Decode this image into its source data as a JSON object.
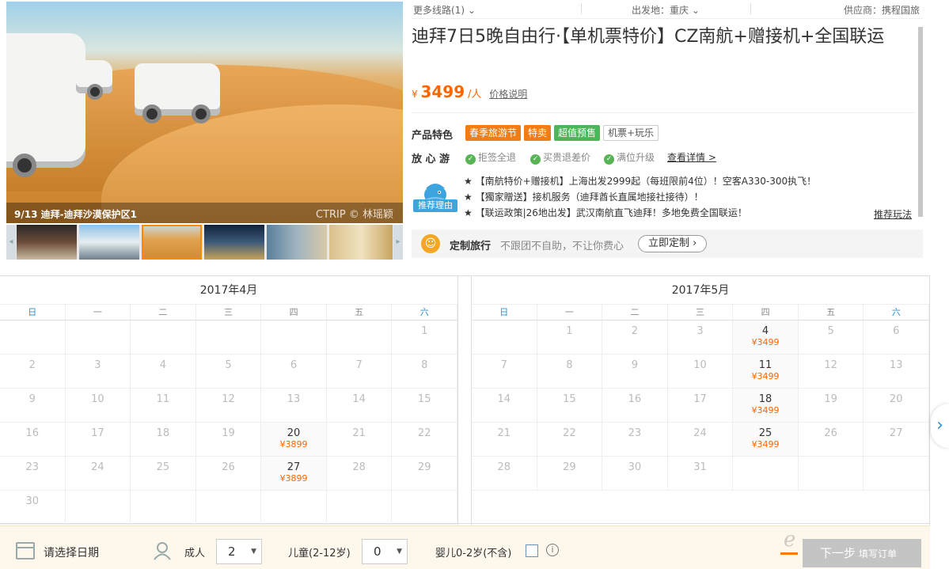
{
  "gallery": {
    "caption": "9/13 迪拜-迪拜沙漠保护区1",
    "watermark": "CTRIP © 林瑶颖"
  },
  "topbar": {
    "routes": "更多线路(1) ⌄",
    "departure": "出发地：重庆 ⌄",
    "supplier": "供应商：携程国旅"
  },
  "product": {
    "title": "迪拜7日5晚自由行·【单机票特价】CZ南航+赠接机+全国联运",
    "price_symbol": "¥",
    "price": "3499",
    "price_unit": "/人",
    "price_note": "价格说明"
  },
  "features": {
    "label": "产品特色",
    "tags": [
      {
        "text": "春季旅游节",
        "color": "#f07d16"
      },
      {
        "text": "特卖",
        "color": "#f07d16"
      },
      {
        "text": "超值预售",
        "color": "#4eb55b"
      },
      {
        "text": "机票+玩乐",
        "color": "#ffffff"
      }
    ]
  },
  "assurance": {
    "label": "放 心 游",
    "items": [
      "拒签全退",
      "买贵退差价",
      "满位升级"
    ],
    "detail_link": "查看详情 >"
  },
  "recommend": {
    "label": "推荐理由",
    "lines": [
      "★ 【南航特价+赠接机】上海出发2999起（每班限前4位）！空客A330-300执飞！",
      "★ 【獨家贈送】接机服务（迪拜酋长直属地接社接待）！",
      "★ 【联运政策|26地出发】武汉南航直飞迪拜！多地免费全国联运！"
    ],
    "more_link": "推荐玩法"
  },
  "custom": {
    "title": "定制旅行",
    "desc": "不跟团不自助，不让你费心",
    "button": "立即定制 ›"
  },
  "calendar": {
    "weekdays": [
      "日",
      "一",
      "二",
      "三",
      "四",
      "五",
      "六"
    ],
    "months": [
      {
        "title": "2017年4月",
        "first_weekday": 6,
        "days": 30,
        "prices": {
          "20": "¥3899",
          "27": "¥3899"
        }
      },
      {
        "title": "2017年5月",
        "first_weekday": 1,
        "days": 31,
        "prices": {
          "4": "¥3499",
          "11": "¥3499",
          "18": "¥3499",
          "25": "¥3499"
        }
      }
    ]
  },
  "booking": {
    "date_prompt": "请选择日期",
    "adult_label": "成人",
    "adult_value": "2",
    "child_label": "儿童(2-12岁)",
    "child_value": "0",
    "infant_label": "婴儿0-2岁(不含)",
    "next_button": "下一步",
    "next_sub": "填写订单"
  }
}
